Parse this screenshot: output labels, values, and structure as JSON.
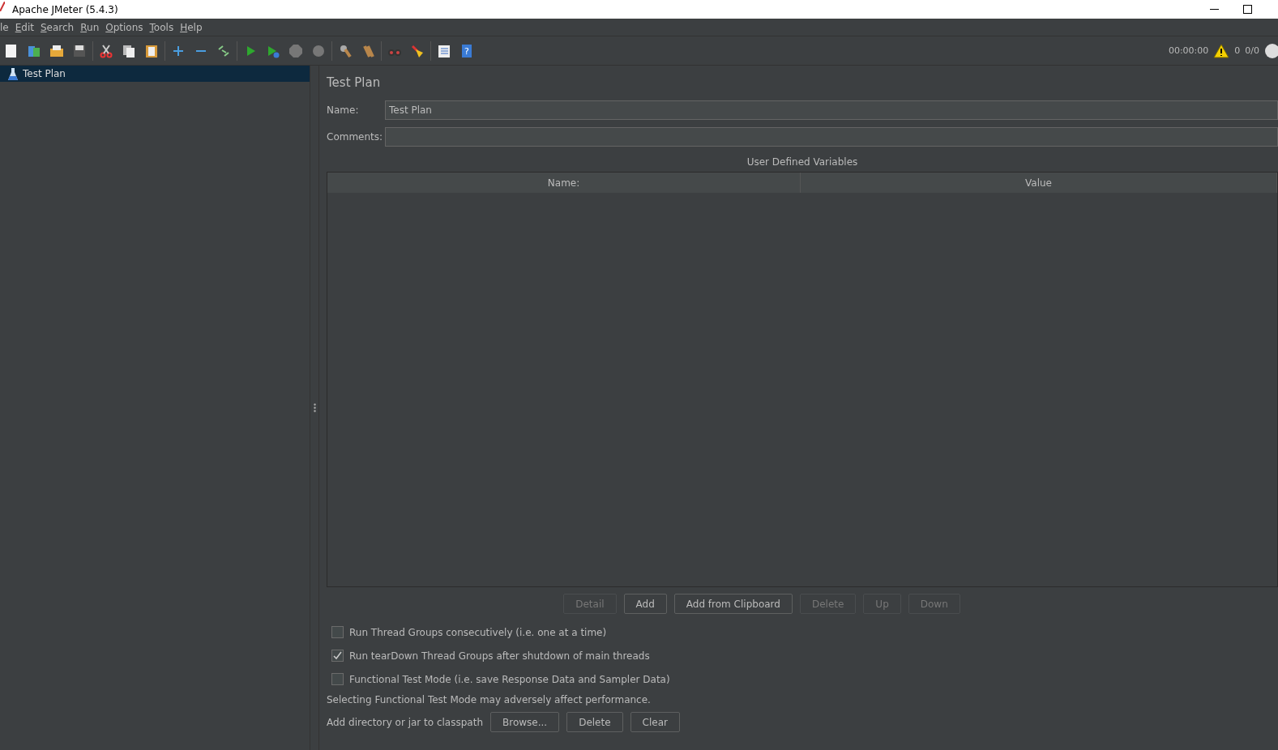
{
  "window": {
    "title": "Apache JMeter (5.4.3)"
  },
  "menu": [
    "le",
    "Edit",
    "Search",
    "Run",
    "Options",
    "Tools",
    "Help"
  ],
  "status": {
    "elapsed": "00:00:00",
    "warnings": "0",
    "threads": "0/0"
  },
  "tree": [
    {
      "label": "Test Plan",
      "selected": true
    }
  ],
  "panel": {
    "title": "Test Plan",
    "name_label": "Name:",
    "name_value": "Test Plan",
    "comments_label": "Comments:"
  },
  "help_glyph": "?",
  "variables": {
    "title": "User Defined Variables",
    "columns": [
      "Name:",
      "Value"
    ]
  },
  "table_buttons": [
    {
      "label": "Detail",
      "disabled": true
    },
    {
      "label": "Add",
      "disabled": false
    },
    {
      "label": "Add from Clipboard",
      "disabled": false
    },
    {
      "label": "Delete",
      "disabled": true
    },
    {
      "label": "Up",
      "disabled": true
    },
    {
      "label": "Down",
      "disabled": true
    }
  ],
  "options": [
    {
      "label": "Run Thread Groups consecutively (i.e. one at a time)",
      "checked": false
    },
    {
      "label": "Run tearDown Thread Groups after shutdown of main threads",
      "checked": true
    },
    {
      "label": "Functional Test Mode (i.e. save Response Data and Sampler Data)",
      "checked": false
    }
  ],
  "note": "Selecting Functional Test Mode may adversely affect performance.",
  "classpath": {
    "label": "Add directory or jar to classpath",
    "buttons": [
      {
        "label": "Browse...",
        "disabled": false
      },
      {
        "label": "Delete",
        "disabled": false
      },
      {
        "label": "Clear",
        "disabled": false
      }
    ]
  }
}
